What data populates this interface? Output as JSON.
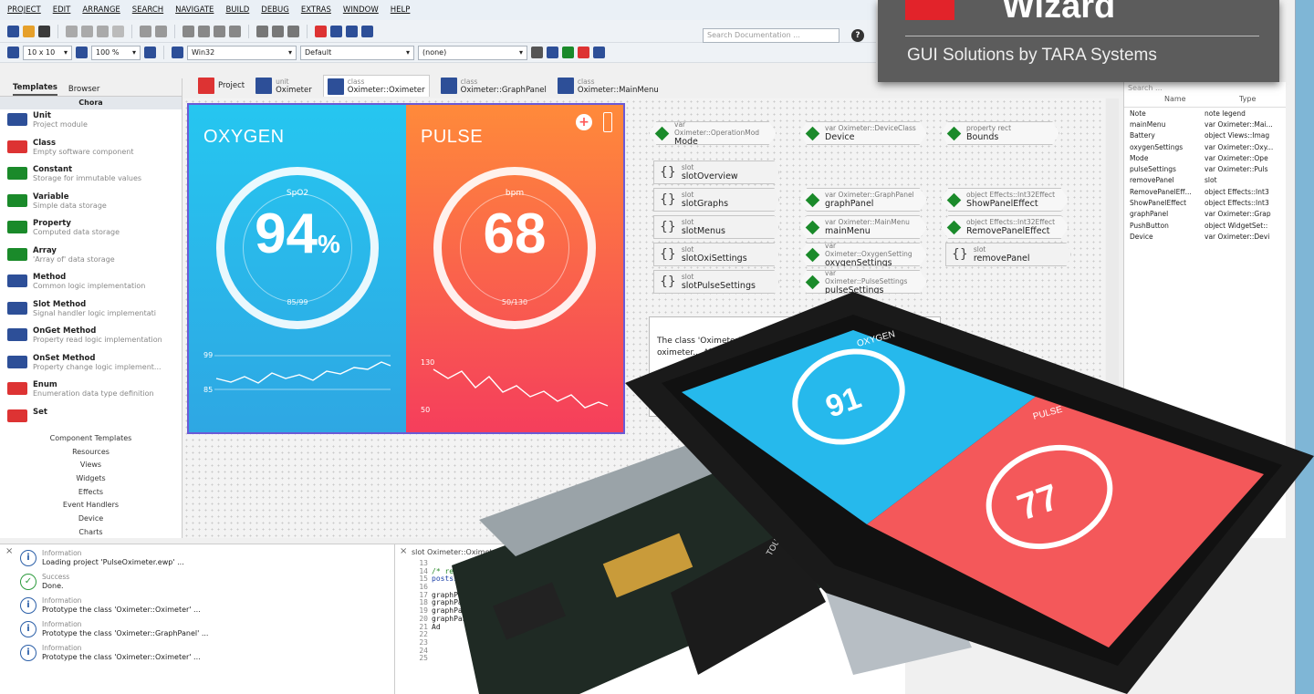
{
  "menu": [
    "PROJECT",
    "EDIT",
    "ARRANGE",
    "SEARCH",
    "NAVIGATE",
    "BUILD",
    "DEBUG",
    "EXTRAS",
    "WINDOW",
    "HELP"
  ],
  "toolbar": {
    "grid": "10 x 10",
    "zoom": "100 %",
    "platform": "Win32",
    "profile": "Default",
    "filter": "(none)",
    "search_placeholder": "Search Documentation ...",
    "help": "?"
  },
  "logo": {
    "word": "Wizard",
    "tagline": "GUI Solutions by TARA Systems"
  },
  "left": {
    "tabs": [
      "Templates",
      "Browser"
    ],
    "section": "Chora",
    "items": [
      {
        "t": "Unit",
        "d": "Project module",
        "c": "#2d4f98"
      },
      {
        "t": "Class",
        "d": "Empty software component",
        "c": "#d33"
      },
      {
        "t": "Constant",
        "d": "Storage for immutable values",
        "c": "#1a8a2a"
      },
      {
        "t": "Variable",
        "d": "Simple data storage",
        "c": "#1a8a2a"
      },
      {
        "t": "Property",
        "d": "Computed data storage",
        "c": "#1a8a2a"
      },
      {
        "t": "Array",
        "d": "'Array of' data storage",
        "c": "#1a8a2a"
      },
      {
        "t": "Method",
        "d": "Common logic implementation",
        "c": "#2d4f98"
      },
      {
        "t": "Slot Method",
        "d": "Signal handler logic implementati",
        "c": "#2d4f98"
      },
      {
        "t": "OnGet Method",
        "d": "Property read logic implementation",
        "c": "#2d4f98"
      },
      {
        "t": "OnSet Method",
        "d": "Property change logic implement...",
        "c": "#2d4f98"
      },
      {
        "t": "Enum",
        "d": "Enumeration data type definition",
        "c": "#d33"
      },
      {
        "t": "Set",
        "d": "",
        "c": "#d33"
      }
    ],
    "categories": [
      "Component Templates",
      "Resources",
      "Views",
      "Widgets",
      "Effects",
      "Event Handlers",
      "Device",
      "Charts"
    ]
  },
  "tabs": [
    {
      "s": "",
      "n": "Project"
    },
    {
      "s": "unit",
      "n": "Oximeter"
    },
    {
      "s": "class",
      "n": "Oximeter::Oximeter"
    },
    {
      "s": "class",
      "n": "Oximeter::GraphPanel"
    },
    {
      "s": "class",
      "n": "Oximeter::MainMenu"
    }
  ],
  "oxy": {
    "head": "OXYGEN",
    "sub": "SpO2",
    "value": "94",
    "unit": "%",
    "range": "85/99",
    "g_hi": "99",
    "g_lo": "85"
  },
  "pulse": {
    "head": "PULSE",
    "sub": "bpm",
    "value": "68",
    "range": "50/130",
    "g_hi": "130",
    "g_lo": "50"
  },
  "nodes": [
    {
      "l1": "var Oximeter::OperationMod",
      "l2": "Mode"
    },
    {
      "l1": "var Oximeter::DeviceClass",
      "l2": "Device"
    },
    {
      "l1": "property rect",
      "l2": "Bounds"
    },
    {
      "l1": "var Oximeter::GraphPanel",
      "l2": "graphPanel"
    },
    {
      "l1": "var Oximeter::MainMenu",
      "l2": "mainMenu"
    },
    {
      "l1": "var Oximeter::OxygenSetting",
      "l2": "oxygenSettings"
    },
    {
      "l1": "var Oximeter::PulseSettings",
      "l2": "pulseSettings"
    },
    {
      "l1": "object Effects::Int32Effect",
      "l2": "ShowPanelEffect"
    },
    {
      "l1": "object Effects::Int32Effect",
      "l2": "RemovePanelEffect"
    }
  ],
  "slots": [
    "slotOverview",
    "slotGraphs",
    "slotMenus",
    "slotOxiSettings",
    "slotPulseSettings",
    "removePanel"
  ],
  "slot_prefix": "slot",
  "note": "The class 'Oximeter' combine... to one application and... pulse oximeter... All temp... the...",
  "right": {
    "search": "Search ...",
    "cols": [
      "Name",
      "Type"
    ],
    "rows": [
      [
        "Note",
        "note legend"
      ],
      [
        "mainMenu",
        "var Oximeter::Mai..."
      ],
      [
        "Battery",
        "object Views::Imag"
      ],
      [
        "oxygenSettings",
        "var Oximeter::Oxy..."
      ],
      [
        "Mode",
        "var Oximeter::Ope"
      ],
      [
        "pulseSettings",
        "var Oximeter::Puls"
      ],
      [
        "removePanel",
        "slot"
      ],
      [
        "RemovePanelEff...",
        "object Effects::Int3"
      ],
      [
        "ShowPanelEffect",
        "object Effects::Int3"
      ],
      [
        "graphPanel",
        "var Oximeter::Grap"
      ],
      [
        "PushButton",
        "object WidgetSet::"
      ],
      [
        "Device",
        "var Oximeter::Devi"
      ]
    ]
  },
  "log": [
    {
      "a": "Information",
      "b": "Loading project 'PulseOximeter.ewp' ...",
      "ok": false
    },
    {
      "a": "Success",
      "b": "Done.",
      "ok": true
    },
    {
      "a": "Information",
      "b": "Prototype the class 'Oximeter::Oximeter' ...",
      "ok": false
    },
    {
      "a": "Information",
      "b": "Prototype the class 'Oximeter::GraphPanel' ...",
      "ok": false
    },
    {
      "a": "Information",
      "b": "Prototype the class 'Oximeter::Oximeter' ...",
      "ok": false
    }
  ],
  "code": {
    "title": "slot Oximeter::Oximeter.slotGraphs",
    "lines": [
      [
        "13",
        ""
      ],
      [
        "14",
        "/* remove any temporary p"
      ],
      [
        "15",
        "postsignal RemovePanel"
      ],
      [
        "16",
        ""
      ],
      [
        "17",
        "graphPanel = new"
      ],
      [
        "18",
        "graphPanel"
      ],
      [
        "19",
        "graphPanel"
      ],
      [
        "20",
        "graphPanel"
      ],
      [
        "21",
        "Ad"
      ],
      [
        "22",
        ""
      ],
      [
        "23",
        ""
      ],
      [
        "24",
        ""
      ],
      [
        "25",
        ""
      ]
    ]
  },
  "hw": {
    "oxy_label": "OXYGEN",
    "oxy_value": "91",
    "pulse_label": "PULSE",
    "pulse_value": "77",
    "board_text": "TOUCHPL00449"
  }
}
